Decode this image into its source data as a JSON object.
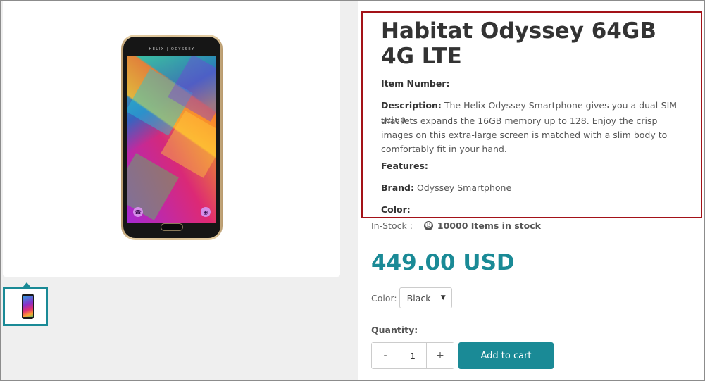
{
  "product": {
    "title": "Habitat Odyssey 64GB 4G LTE",
    "item_number_label": "Item Number:",
    "description_label": "Description:",
    "description_line1": "The Helix Odyssey Smartphone gives you a dual-SIM setup",
    "description_line2": "that lets expands the 16GB memory up to 128. Enjoy the crisp images on this extra-large screen is matched with a slim body to comfortably fit in your hand.",
    "features_label": "Features:",
    "brand_label": "Brand:",
    "brand_value": "Odyssey Smartphone",
    "color_label": "Color:",
    "phone_brand_text": "HELIX | ODYSSEY"
  },
  "stock": {
    "label": "In-Stock :",
    "value": "10000 Items in stock"
  },
  "price": "449.00 USD",
  "options": {
    "color_label": "Color:",
    "color_selected": "Black"
  },
  "quantity": {
    "label": "Quantity:",
    "minus": "-",
    "value": "1",
    "plus": "+"
  },
  "add_to_cart_label": "Add to cart",
  "colors": {
    "accent": "#1a8a96",
    "highlight_border": "#a31218"
  }
}
